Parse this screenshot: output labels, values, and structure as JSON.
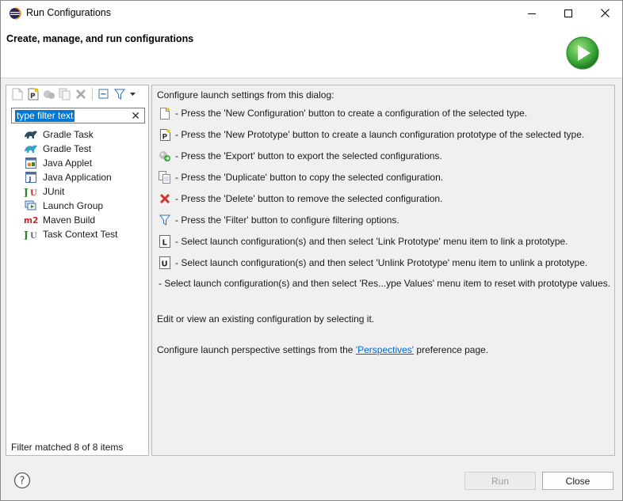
{
  "window": {
    "title": "Run Configurations"
  },
  "header": {
    "title": "Create, manage, and run configurations"
  },
  "toolbar": {
    "buttons": [
      "new-configuration-icon",
      "new-prototype-icon",
      "export-icon",
      "duplicate-icon",
      "delete-icon",
      "collapse-all-icon",
      "filter-icon",
      "view-menu-icon"
    ]
  },
  "filter": {
    "value": "type filter text",
    "clear": "✕"
  },
  "tree": {
    "items": [
      {
        "label": "Gradle Task",
        "icon": "gradle-task-icon"
      },
      {
        "label": "Gradle Test",
        "icon": "gradle-test-icon"
      },
      {
        "label": "Java Applet",
        "icon": "java-applet-icon"
      },
      {
        "label": "Java Application",
        "icon": "java-application-icon"
      },
      {
        "label": "JUnit",
        "icon": "junit-icon"
      },
      {
        "label": "Launch Group",
        "icon": "launch-group-icon"
      },
      {
        "label": "Maven Build",
        "icon": "maven-build-icon"
      },
      {
        "label": "Task Context Test",
        "icon": "task-context-test-icon"
      }
    ],
    "status": "Filter matched 8 of 8 items"
  },
  "content": {
    "intro": "Configure launch settings from this dialog:",
    "instructions": [
      "- Press the 'New Configuration' button to create a configuration of the selected type.",
      "- Press the 'New Prototype' button to create a launch configuration prototype of the selected type.",
      "- Press the 'Export' button to export the selected configurations.",
      "- Press the 'Duplicate' button to copy the selected configuration.",
      "- Press the 'Delete' button to remove the selected configuration.",
      "- Press the 'Filter' button to configure filtering options.",
      "- Select launch configuration(s) and then select 'Link Prototype' menu item to link a prototype.",
      "- Select launch configuration(s) and then select 'Unlink Prototype' menu item to unlink a prototype.",
      "- Select launch configuration(s) and then select 'Res...ype Values' menu item to reset with prototype values."
    ],
    "edit_hint": "Edit or view an existing configuration by selecting it.",
    "perspective_prefix": "Configure launch perspective settings from the ",
    "perspective_link": "'Perspectives'",
    "perspective_suffix": " preference page."
  },
  "footer": {
    "run_label": "Run",
    "close_label": "Close",
    "help": "?"
  },
  "colors": {
    "accent": "#0078d7",
    "link": "#0066cc",
    "run_green": "#3aa63a"
  }
}
